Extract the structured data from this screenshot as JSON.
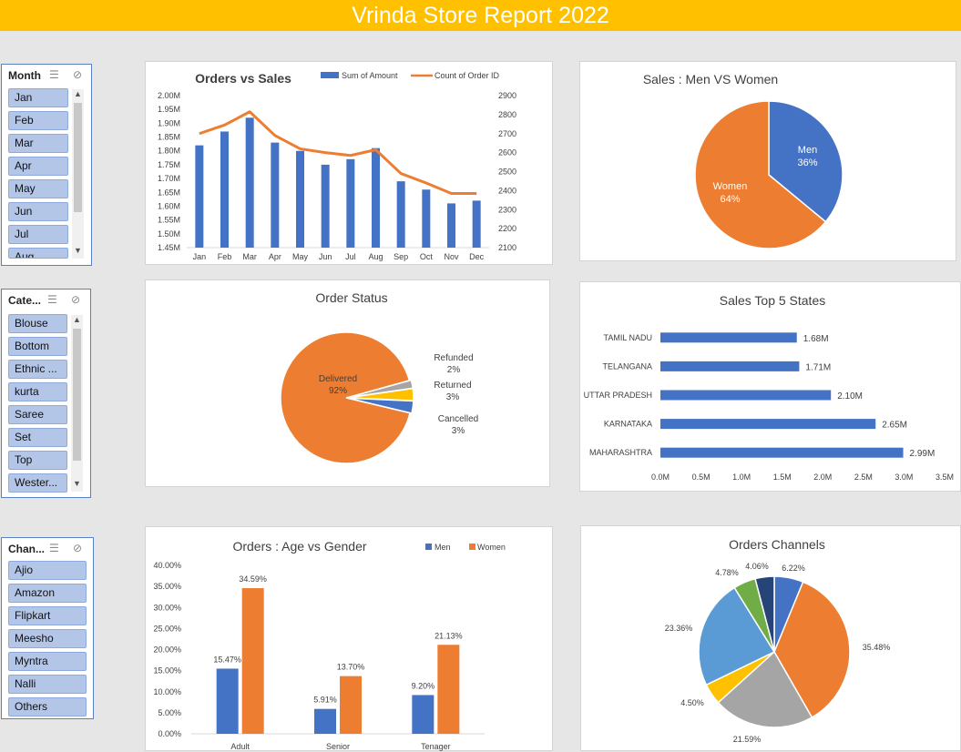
{
  "banner_title": "Vrinda Store Report 2022",
  "slicers": {
    "month": {
      "title": "Month",
      "items": [
        "Jan",
        "Feb",
        "Mar",
        "Apr",
        "May",
        "Jun",
        "Jul",
        "Aug"
      ]
    },
    "category": {
      "title": "Cate...",
      "items": [
        "Blouse",
        "Bottom",
        "Ethnic ...",
        "kurta",
        "Saree",
        "Set",
        "Top",
        "Wester..."
      ]
    },
    "channel": {
      "title": "Chan...",
      "items": [
        "Ajio",
        "Amazon",
        "Flipkart",
        "Meesho",
        "Myntra",
        "Nalli",
        "Others"
      ]
    }
  },
  "colors": {
    "blue": "#4472c4",
    "orange": "#ed7d31",
    "gray": "#a5a5a5",
    "yellow": "#ffc000",
    "lightblue": "#5b9bd5",
    "green": "#70ad47",
    "navy": "#264478",
    "banner": "#ffc000"
  },
  "chart_data": [
    {
      "id": "orders-vs-sales",
      "type": "bar",
      "title": "Orders vs Sales",
      "categories": [
        "Jan",
        "Feb",
        "Mar",
        "Apr",
        "May",
        "Jun",
        "Jul",
        "Aug",
        "Sep",
        "Oct",
        "Nov",
        "Dec"
      ],
      "series": [
        {
          "name": "Sum of Amount",
          "kind": "bar",
          "axis": "left",
          "color": "#4472c4",
          "values": [
            1.82,
            1.87,
            1.92,
            1.83,
            1.8,
            1.75,
            1.77,
            1.81,
            1.69,
            1.66,
            1.61,
            1.62
          ]
        },
        {
          "name": "Count of Order ID",
          "kind": "line",
          "axis": "right",
          "color": "#ed7d31",
          "values": [
            2700,
            2745,
            2815,
            2690,
            2620,
            2600,
            2585,
            2615,
            2490,
            2440,
            2385,
            2385
          ]
        }
      ],
      "y_left": {
        "min": 1.45,
        "max": 2.0,
        "ticks": [
          "1.45M",
          "1.50M",
          "1.55M",
          "1.60M",
          "1.65M",
          "1.70M",
          "1.75M",
          "1.80M",
          "1.85M",
          "1.90M",
          "1.95M",
          "2.00M"
        ]
      },
      "y_right": {
        "min": 2100,
        "max": 2900,
        "ticks": [
          "2100",
          "2200",
          "2300",
          "2400",
          "2500",
          "2600",
          "2700",
          "2800",
          "2900"
        ]
      },
      "legend": "top-right"
    },
    {
      "id": "men-vs-women",
      "type": "pie",
      "title": "Sales : Men VS Women",
      "slices": [
        {
          "label": "Men",
          "value": 36,
          "pct_text": "36%",
          "color": "#4472c4"
        },
        {
          "label": "Women",
          "value": 64,
          "pct_text": "64%",
          "color": "#ed7d31"
        }
      ]
    },
    {
      "id": "order-status",
      "type": "pie",
      "title": "Order Status",
      "slices": [
        {
          "label": "Delivered",
          "value": 92,
          "pct_text": "92%",
          "color": "#ed7d31"
        },
        {
          "label": "Cancelled",
          "value": 3,
          "pct_text": "3%",
          "color": "#4472c4"
        },
        {
          "label": "Returned",
          "value": 3,
          "pct_text": "3%",
          "color": "#ffc000"
        },
        {
          "label": "Refunded",
          "value": 2,
          "pct_text": "2%",
          "color": "#a5a5a5"
        }
      ]
    },
    {
      "id": "top-states",
      "type": "bar",
      "orientation": "horizontal",
      "title": "Sales Top 5 States",
      "categories": [
        "TAMIL NADU",
        "TELANGANA",
        "UTTAR PRADESH",
        "KARNATAKA",
        "MAHARASHTRA"
      ],
      "values": [
        1.68,
        1.71,
        2.1,
        2.65,
        2.99
      ],
      "value_labels": [
        "1.68M",
        "1.71M",
        "2.10M",
        "2.65M",
        "2.99M"
      ],
      "xlim": [
        0,
        3.5
      ],
      "x_ticks": [
        "0.0M",
        "0.5M",
        "1.0M",
        "1.5M",
        "2.0M",
        "2.5M",
        "3.0M",
        "3.5M"
      ]
    },
    {
      "id": "age-vs-gender",
      "type": "bar",
      "title": "Orders : Age vs Gender",
      "categories": [
        "Adult",
        "Senior",
        "Tenager"
      ],
      "series": [
        {
          "name": "Men",
          "color": "#4472c4",
          "values": [
            15.47,
            5.91,
            9.2
          ],
          "labels": [
            "15.47%",
            "5.91%",
            "9.20%"
          ]
        },
        {
          "name": "Women",
          "color": "#ed7d31",
          "values": [
            34.59,
            13.7,
            21.13
          ],
          "labels": [
            "34.59%",
            "13.70%",
            "21.13%"
          ]
        }
      ],
      "ylim": [
        0,
        40
      ],
      "y_ticks": [
        "0.00%",
        "5.00%",
        "10.00%",
        "15.00%",
        "20.00%",
        "25.00%",
        "30.00%",
        "35.00%",
        "40.00%"
      ],
      "legend": "top-right"
    },
    {
      "id": "orders-channels",
      "type": "pie",
      "title": "Orders Channels",
      "slices": [
        {
          "value": 6.22,
          "pct_text": "6.22%",
          "color": "#4472c4"
        },
        {
          "value": 35.48,
          "pct_text": "35.48%",
          "color": "#ed7d31"
        },
        {
          "value": 21.59,
          "pct_text": "21.59%",
          "color": "#a5a5a5"
        },
        {
          "value": 4.5,
          "pct_text": "4.50%",
          "color": "#ffc000"
        },
        {
          "value": 23.36,
          "pct_text": "23.36%",
          "color": "#5b9bd5"
        },
        {
          "value": 4.78,
          "pct_text": "4.78%",
          "color": "#70ad47"
        },
        {
          "value": 4.06,
          "pct_text": "4.06%",
          "color": "#264478"
        }
      ]
    }
  ]
}
